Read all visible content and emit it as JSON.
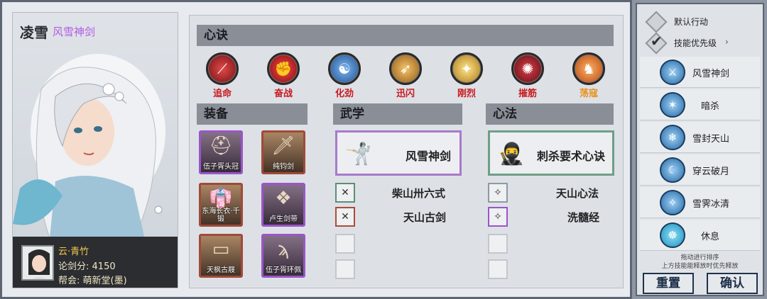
{
  "character": {
    "name": "凌雪",
    "title": "风雪神剑",
    "player_name": "云·青竹",
    "score_label": "论剑分:",
    "score_value": "4150",
    "guild_label": "帮会:",
    "guild_value": "萌新堂(墨)"
  },
  "xinjue": {
    "title": "心诀",
    "skills": [
      {
        "label": "追命",
        "icon": "claw-slash-icon",
        "color": "#b0151b",
        "label_color": "#c7191e"
      },
      {
        "label": "奋战",
        "icon": "fist-icon",
        "color": "#b7141b",
        "label_color": "#c7191e"
      },
      {
        "label": "化劲",
        "icon": "swirl-icon",
        "color": "#2b67b8",
        "label_color": "#c7191e"
      },
      {
        "label": "迅闪",
        "icon": "dash-icon",
        "color": "#cf8a22",
        "label_color": "#c7191e"
      },
      {
        "label": "刚烈",
        "icon": "strength-icon",
        "color": "#d9a62c",
        "label_color": "#c7191e"
      },
      {
        "label": "摧筋",
        "icon": "bone-icon",
        "color": "#9a1a22",
        "label_color": "#c7191e"
      },
      {
        "label": "荡寇",
        "icon": "horse-icon",
        "color": "#e06a1b",
        "label_color": "#e7901a"
      }
    ]
  },
  "equipment": {
    "title": "装备",
    "slots": [
      {
        "name": "伍子胥头冠",
        "icon": "helmet-icon",
        "border": "purple"
      },
      {
        "name": "纯钧剑",
        "icon": "sword-icon",
        "border": "red"
      },
      {
        "name": "东海长衣·千锻",
        "icon": "robe-icon",
        "border": "red"
      },
      {
        "name": "卢生剑带",
        "icon": "belt-icon",
        "border": "purple"
      },
      {
        "name": "天枫古屐",
        "icon": "sandals-icon",
        "border": "red"
      },
      {
        "name": "伍子胥环佩",
        "icon": "pendant-icon",
        "border": "purple"
      }
    ]
  },
  "wuxue": {
    "title": "武学",
    "main": "风雪神剑",
    "items": [
      "柴山卅六式",
      "天山古剑"
    ]
  },
  "xinfa": {
    "title": "心法",
    "main": "刺杀要术心诀",
    "items": [
      "天山心法",
      "洗髓经"
    ]
  },
  "sidebar": {
    "default_action": "默认行动",
    "skill_priority": "技能优先级",
    "skills": [
      "风雪神剑",
      "暗杀",
      "雪封天山",
      "穿云破月",
      "雪霁冰清",
      "休息"
    ],
    "hint_line1": "拖动进行排序",
    "hint_line2": "上方技能能释放时优先释放",
    "reset_label": "重置",
    "confirm_label": "确认"
  }
}
